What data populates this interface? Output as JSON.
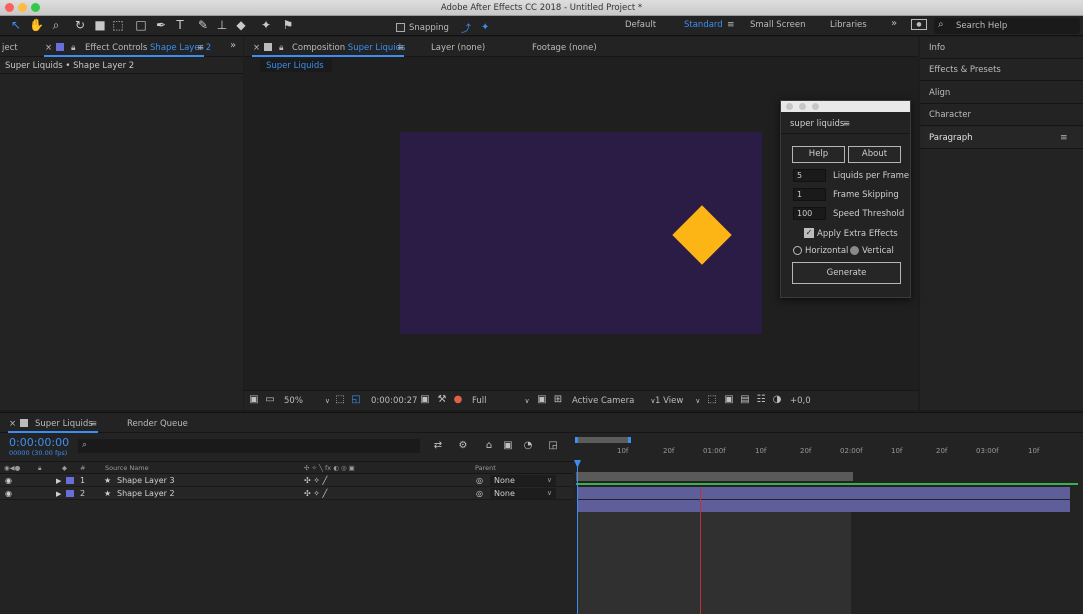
{
  "window": {
    "title": "Adobe After Effects CC 2018 - Untitled Project *"
  },
  "toolbar": {
    "snapping_label": "Snapping",
    "workspaces": [
      "Default",
      "Standard",
      "Small Screen",
      "Libraries"
    ],
    "active_workspace": "Standard",
    "search_help": "Search Help"
  },
  "left_panel": {
    "tab_project_partial": "ject",
    "tab_effect_controls_prefix": "Effect Controls",
    "tab_effect_controls_layer": "Shape Layer 2",
    "breadcrumb": "Super Liquids • Shape Layer 2"
  },
  "comp_panel": {
    "tab_prefix": "Composition",
    "tab_name": "Super Liquids",
    "tab_layer": "Layer (none)",
    "tab_footage": "Footage (none)",
    "subtab": "Super Liquids",
    "footer": {
      "zoom": "50%",
      "timecode": "0:00:00:27",
      "resolution": "Full",
      "camera": "Active Camera",
      "views": "1 View",
      "exposure": "+0,0"
    }
  },
  "right_panel": {
    "items": [
      "Info",
      "Effects & Presets",
      "Align",
      "Character",
      "Paragraph"
    ]
  },
  "super_liquids": {
    "title": "super liquids",
    "help_label": "Help",
    "about_label": "About",
    "liquids_per_frame_value": "5",
    "liquids_per_frame_label": "Liquids per Frame",
    "frame_skipping_value": "1",
    "frame_skipping_label": "Frame Skipping",
    "speed_threshold_value": "100",
    "speed_threshold_label": "Speed Threshold",
    "apply_extra_label": "Apply Extra Effects",
    "horizontal_label": "Horizontal",
    "vertical_label": "Vertical",
    "generate_label": "Generate"
  },
  "timeline": {
    "tab_comp": "Super Liquids",
    "tab_render": "Render Queue",
    "timecode": "0:00:00:00",
    "fps": "00000 (30.00 fps)",
    "search_placeholder": "⌕",
    "col_num": "#",
    "col_source": "Source Name",
    "col_parent": "Parent",
    "layers": [
      {
        "num": "1",
        "name": "Shape Layer 3",
        "parent": "None"
      },
      {
        "num": "2",
        "name": "Shape Layer 2",
        "parent": "None"
      }
    ],
    "ruler": [
      "10f",
      "20f",
      "01:00f",
      "10f",
      "20f",
      "02:00f",
      "10f",
      "20f",
      "03:00f",
      "10f"
    ]
  },
  "colors": {
    "accent": "#3c8ff0",
    "comp_bg": "#2b1c46",
    "shape": "#fdb515",
    "layer_bar": "#5e5e9a",
    "label": "#6a6ed8"
  }
}
